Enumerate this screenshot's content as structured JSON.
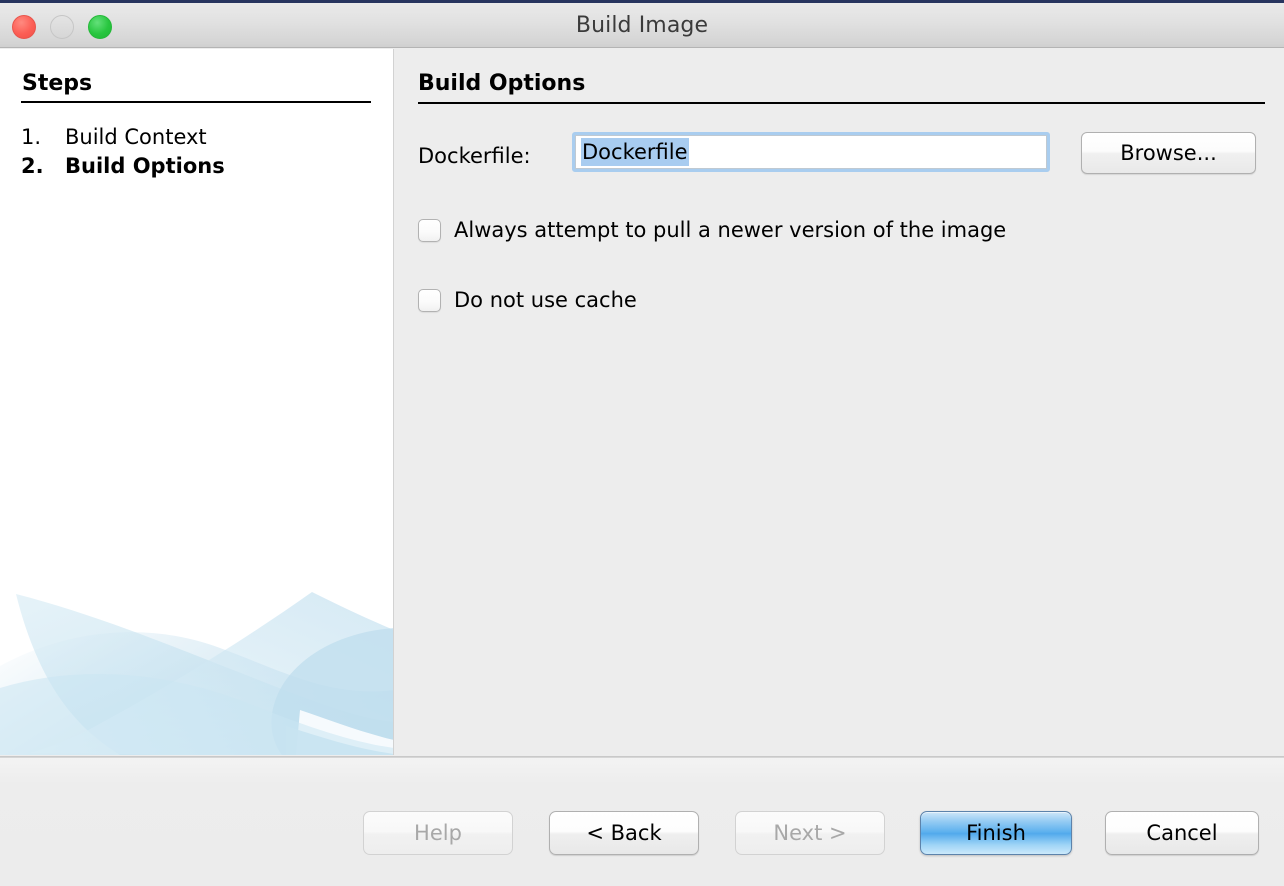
{
  "window": {
    "title": "Build Image",
    "traffic_lights": [
      {
        "name": "close",
        "color": "#fc5e55"
      },
      {
        "name": "minimize",
        "color": "#dcdcdc"
      },
      {
        "name": "zoom",
        "color": "#28c63f"
      }
    ]
  },
  "sidebar": {
    "heading": "Steps",
    "steps": [
      {
        "number": "1.",
        "label": "Build Context",
        "current": false
      },
      {
        "number": "2.",
        "label": "Build Options",
        "current": true
      }
    ]
  },
  "pane": {
    "heading": "Build Options",
    "dockerfile": {
      "label": "Dockerfile:",
      "value": "Dockerfile",
      "placeholder": "Dockerfile",
      "selected": true,
      "browse_label": "Browse..."
    },
    "checkboxes": [
      {
        "label": "Always attempt to pull a newer version of the image",
        "checked": false
      },
      {
        "label": "Do not use cache",
        "checked": false
      }
    ]
  },
  "footer": {
    "buttons": [
      {
        "label": "Help",
        "state": "disabled"
      },
      {
        "label": "< Back",
        "state": "enabled"
      },
      {
        "label": "Next >",
        "state": "disabled"
      },
      {
        "label": "Finish",
        "state": "default"
      },
      {
        "label": "Cancel",
        "state": "enabled"
      }
    ]
  },
  "colors": {
    "accent_blue": "#51a9ec",
    "selection_blue": "#a8ccf0",
    "focus_ring": "#a9cdef",
    "watermark_blue": "#c9e3f0",
    "window_bg": "#ededed",
    "sidebar_bg": "#ffffff"
  }
}
